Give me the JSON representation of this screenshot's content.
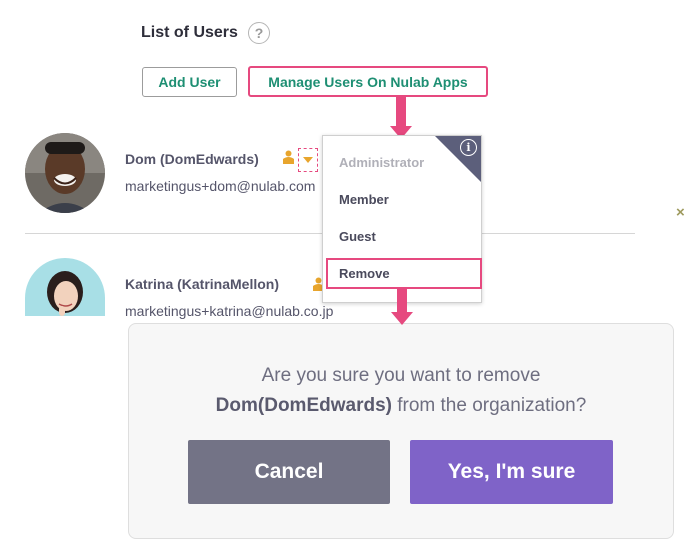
{
  "header": {
    "title": "List of Users",
    "help_icon": "?"
  },
  "toolbar": {
    "add_user_label": "Add User",
    "manage_users_label": "Manage Users On Nulab Apps"
  },
  "users": [
    {
      "name": "Dom (DomEdwards)",
      "email": "marketingus+dom@nulab.com",
      "role_icon": "admin-person-icon"
    },
    {
      "name": "Katrina (KatrinaMellon)",
      "email": "marketingus+katrina@nulab.co.jp",
      "role_icon": "admin-person-icon"
    }
  ],
  "role_dropdown": {
    "items": [
      "Administrator",
      "Member",
      "Guest",
      "Remove"
    ],
    "disabled_item": "Administrator",
    "highlighted_item": "Remove",
    "info_icon": "i"
  },
  "close_icon": "×",
  "modal": {
    "line1": "Are you sure you want to remove",
    "line2_bold": "Dom(DomEdwards)",
    "line2_rest": " from the organization?",
    "cancel_label": "Cancel",
    "confirm_label": "Yes, I'm sure"
  },
  "colors": {
    "highlight": "#e6497f",
    "accent_green": "#1e8f73",
    "confirm": "#7f63c8",
    "cancel": "#737386",
    "role_badge": "#e8a52d"
  }
}
